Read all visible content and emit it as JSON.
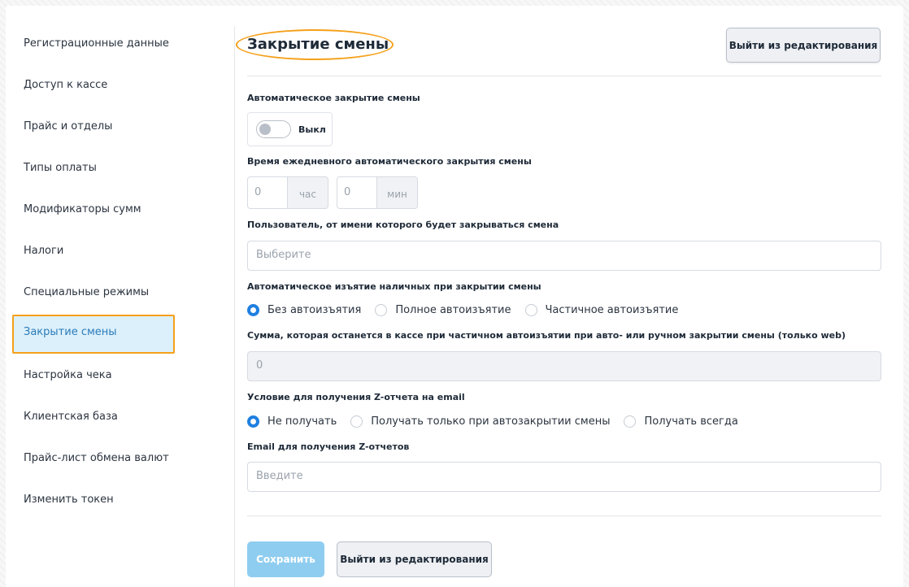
{
  "sidebar": {
    "items": [
      {
        "label": "Регистрационные данные"
      },
      {
        "label": "Доступ к кассе"
      },
      {
        "label": "Прайс и отделы"
      },
      {
        "label": "Типы оплаты"
      },
      {
        "label": "Модификаторы сумм"
      },
      {
        "label": "Налоги"
      },
      {
        "label": "Специальные режимы"
      },
      {
        "label": "Закрытие смены",
        "active": true
      },
      {
        "label": "Настройка чека"
      },
      {
        "label": "Клиентская база"
      },
      {
        "label": "Прайс-лист обмена валют"
      },
      {
        "label": "Изменить токен"
      }
    ]
  },
  "header": {
    "title": "Закрытие смены",
    "exit_label": "Выйти из редактирования"
  },
  "form": {
    "auto_close_label": "Автоматическое закрытие смены",
    "auto_close_toggle": "Выкл",
    "time_label": "Время ежедневного автоматического закрытия смены",
    "hour_value": "0",
    "hour_unit": "час",
    "minute_value": "0",
    "minute_unit": "мин",
    "user_label": "Пользователь, от имени которого будет закрываться смена",
    "user_placeholder": "Выберите",
    "withdrawal_label": "Автоматическое изъятие наличных при закрытии смены",
    "withdrawal_options": [
      "Без автоизъятия",
      "Полное автоизъятие",
      "Частичное автоизъятие"
    ],
    "remaining_label": "Сумма, которая останется в кассе при частичном автоизъятии при авто- или ручном закрытии смены (только web)",
    "remaining_value": "0",
    "z_report_label": "Условие для получения Z-отчета на email",
    "z_report_options": [
      "Не получать",
      "Получать только при автозакрытии смены",
      "Получать всегда"
    ],
    "email_label": "Email для получения Z-отчетов",
    "email_placeholder": "Введите"
  },
  "footer": {
    "save_label": "Сохранить",
    "exit_label": "Выйти из редактирования"
  },
  "colors": {
    "accent": "#1f7fe0",
    "highlight": "#f5a01a",
    "save_disabled": "#8fcdf0"
  }
}
